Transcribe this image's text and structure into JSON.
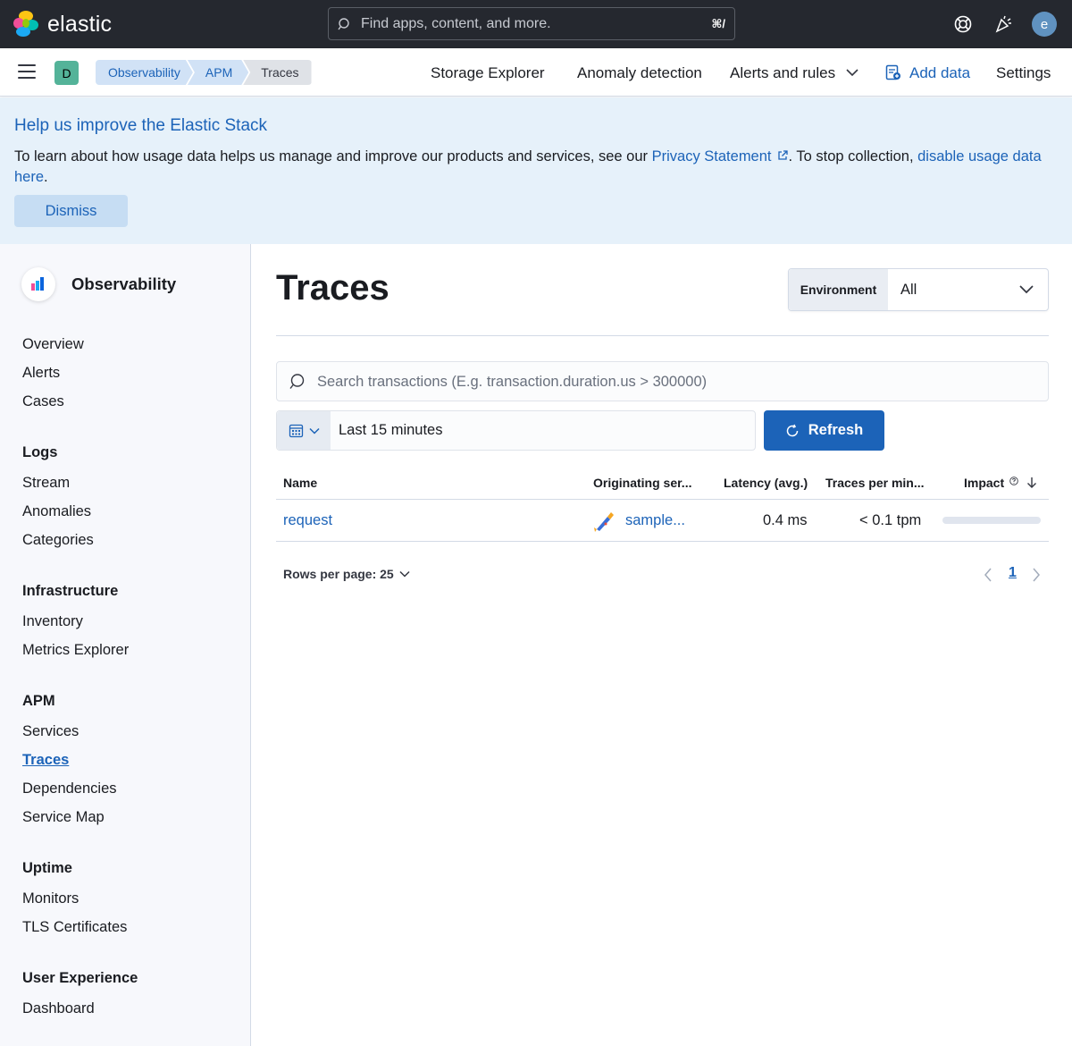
{
  "header": {
    "brand": "elastic",
    "search_placeholder": "Find apps, content, and more.",
    "search_shortcut": "⌘/",
    "user_initial": "e"
  },
  "subnav": {
    "space_initial": "D",
    "breadcrumbs": [
      "Observability",
      "APM",
      "Traces"
    ],
    "links": [
      "Storage Explorer",
      "Anomaly detection",
      "Alerts and rules",
      "Add data",
      "Settings"
    ]
  },
  "banner": {
    "title": "Help us improve the Elastic Stack",
    "text_before": "To learn about how usage data helps us manage and improve our products and services, see our ",
    "privacy_link": "Privacy Statement",
    "text_middle": ". To stop collection, ",
    "disable_link": "disable usage data here",
    "text_after": ".",
    "dismiss_label": "Dismiss"
  },
  "sidebar": {
    "title": "Observability",
    "top_items": [
      "Overview",
      "Alerts",
      "Cases"
    ],
    "sections": [
      {
        "heading": "Logs",
        "items": [
          "Stream",
          "Anomalies",
          "Categories"
        ]
      },
      {
        "heading": "Infrastructure",
        "items": [
          "Inventory",
          "Metrics Explorer"
        ]
      },
      {
        "heading": "APM",
        "items": [
          "Services",
          "Traces",
          "Dependencies",
          "Service Map"
        ]
      },
      {
        "heading": "Uptime",
        "items": [
          "Monitors",
          "TLS Certificates"
        ]
      },
      {
        "heading": "User Experience",
        "items": [
          "Dashboard"
        ]
      }
    ],
    "active_item": "Traces"
  },
  "main": {
    "title": "Traces",
    "environment_label": "Environment",
    "environment_value": "All",
    "search_placeholder": "Search transactions (E.g. transaction.duration.us > 300000)",
    "time_range": "Last 15 minutes",
    "refresh_label": "Refresh",
    "table": {
      "columns": [
        "Name",
        "Originating ser...",
        "Latency (avg.)",
        "Traces per min...",
        "Impact"
      ],
      "rows": [
        {
          "name": "request",
          "service": "sample...",
          "latency": "0.4 ms",
          "tpm": "< 0.1 tpm",
          "impact": 0
        }
      ]
    },
    "rows_per_page": "Rows per page: 25",
    "current_page": "1"
  },
  "colors": {
    "header_bg": "#25282f",
    "accent": "#1c63b8",
    "banner_bg": "#e6f1fa",
    "space_badge": "#54b399"
  }
}
